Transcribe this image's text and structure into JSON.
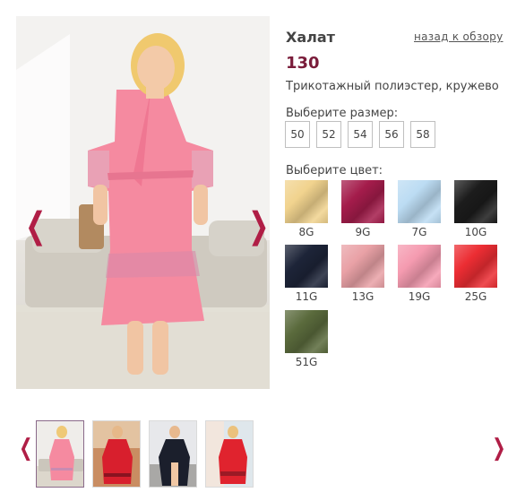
{
  "product": {
    "title": "Халат",
    "back_link": "назад к обзору",
    "price": "130",
    "material": "Трикотажный полиэстер, кружево"
  },
  "sizes": {
    "label": "Выберите размер:",
    "options": [
      "50",
      "52",
      "54",
      "56",
      "58"
    ]
  },
  "colors": {
    "label": "Выберите цвет:",
    "options": [
      {
        "code": "8G",
        "color": "#f1d38e"
      },
      {
        "code": "9G",
        "color": "#a41c4b"
      },
      {
        "code": "7G",
        "color": "#bcdcf3"
      },
      {
        "code": "10G",
        "color": "#1c1c1c"
      },
      {
        "code": "11G",
        "color": "#1d2438"
      },
      {
        "code": "13G",
        "color": "#e9a1a6"
      },
      {
        "code": "19G",
        "color": "#f59bb0"
      },
      {
        "code": "25G",
        "color": "#ec2d33"
      },
      {
        "code": "51G",
        "color": "#5a6a3c"
      }
    ]
  },
  "gallery": {
    "prev_arrow": "❮",
    "next_arrow": "❯",
    "thumbnails": [
      "pink-robe",
      "red-robe",
      "black-robe",
      "red-robe-garden"
    ]
  },
  "accent_color": "#b01e46"
}
